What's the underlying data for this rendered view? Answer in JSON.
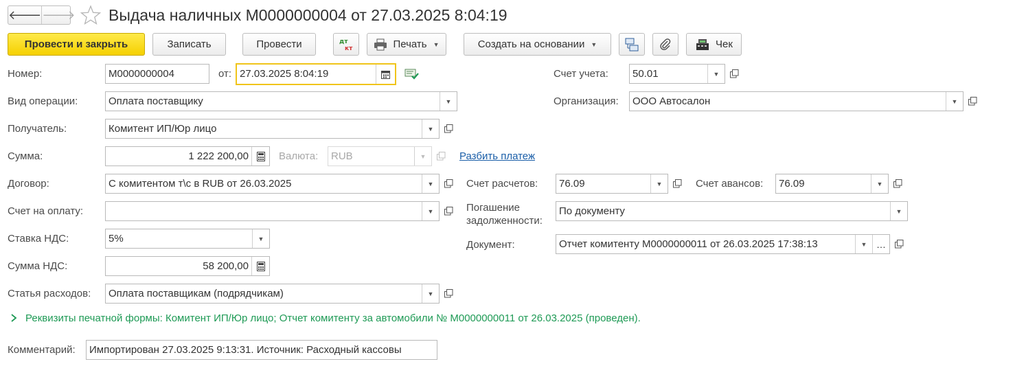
{
  "nav": {
    "back_icon": "arrow-left-icon",
    "forward_icon": "arrow-right-icon"
  },
  "title": "Выдача наличных М0000000004 от 27.03.2025 8:04:19",
  "toolbar": {
    "post_close": "Провести и закрыть",
    "save": "Записать",
    "post": "Провести",
    "dtkt_icon": "dt-kt-icon",
    "print": "Печать",
    "create_based": "Создать на основании",
    "check": "Чек"
  },
  "form": {
    "number_label": "Номер:",
    "number_value": "М0000000004",
    "date_label": "от:",
    "date_value": "27.03.2025  8:04:19",
    "account_label": "Счет учета:",
    "account_value": "50.01",
    "operation_label": "Вид операции:",
    "operation_value": "Оплата поставщику",
    "organization_label": "Организация:",
    "organization_value": "ООО Автосалон",
    "recipient_label": "Получатель:",
    "recipient_value": "Комитент ИП/Юр лицо",
    "amount_label": "Сумма:",
    "amount_value": "1 222 200,00",
    "currency_label": "Валюта:",
    "currency_value": "RUB",
    "split_link": "Разбить платеж",
    "contract_label": "Договор:",
    "contract_value": "С комитентом т\\с в RUB от 26.03.2025",
    "settlement_label": "Счет расчетов:",
    "settlement_value": "76.09",
    "advance_label": "Счет авансов:",
    "advance_value": "76.09",
    "invoice_label": "Счет на оплату:",
    "invoice_value": "",
    "repayment_label_1": "Погашение",
    "repayment_label_2": "задолженности:",
    "repayment_value": "По документу",
    "vat_rate_label": "Ставка НДС:",
    "vat_rate_value": "5%",
    "document_label": "Документ:",
    "document_value": "Отчет комитенту М0000000011 от 26.03.2025 17:38:13",
    "vat_amount_label": "Сумма НДС:",
    "vat_amount_value": "58 200,00",
    "expense_label": "Статья расходов:",
    "expense_value": "Оплата поставщикам (подрядчикам)",
    "print_details": "Реквизиты печатной формы: Комитент ИП/Юр лицо; Отчет комитенту за автомобили № М0000000011 от 26.03.2025 (проведен).",
    "comment_label": "Комментарий:",
    "comment_value": "Импортирован 27.03.2025 9:13:31. Источник: Расходный кассовы"
  }
}
